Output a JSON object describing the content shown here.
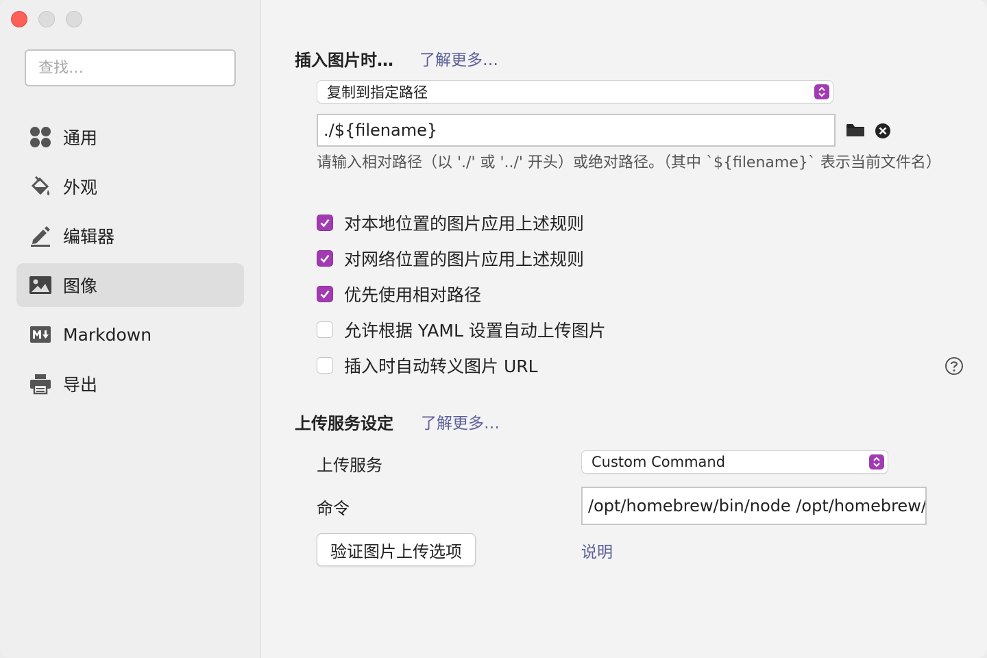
{
  "sidebar": {
    "search_placeholder": "查找…",
    "items": [
      {
        "label": "通用",
        "icon": "grid-icon"
      },
      {
        "label": "外观",
        "icon": "paint-bucket-icon"
      },
      {
        "label": "编辑器",
        "icon": "pencil-icon"
      },
      {
        "label": "图像",
        "icon": "image-icon",
        "active": true
      },
      {
        "label": "Markdown",
        "icon": "markdown-icon"
      },
      {
        "label": "导出",
        "icon": "printer-icon"
      }
    ]
  },
  "image_section": {
    "title": "插入图片时…",
    "learn_more": "了解更多…",
    "action_select": "复制到指定路径",
    "path_value": "./${filename}",
    "hint": "请输入相对路径（以 './' 或 '../' 开头）或绝对路径。（其中 `${filename}` 表示当前文件名）",
    "options": [
      {
        "label": "对本地位置的图片应用上述规则",
        "checked": true
      },
      {
        "label": "对网络位置的图片应用上述规则",
        "checked": true
      },
      {
        "label": "优先使用相对路径",
        "checked": true
      },
      {
        "label": "允许根据 YAML 设置自动上传图片",
        "checked": false
      },
      {
        "label": "插入时自动转义图片 URL",
        "checked": false
      }
    ]
  },
  "upload_section": {
    "title": "上传服务设定",
    "learn_more": "了解更多…",
    "service_label": "上传服务",
    "service_value": "Custom Command",
    "command_label": "命令",
    "command_value": "/opt/homebrew/bin/node /opt/homebrew/bir",
    "verify_button": "验证图片上传选项",
    "explain_link": "说明"
  },
  "colors": {
    "accent": "#a23bb2",
    "link": "#5b5f9a",
    "close_button": "#fe5f57"
  }
}
